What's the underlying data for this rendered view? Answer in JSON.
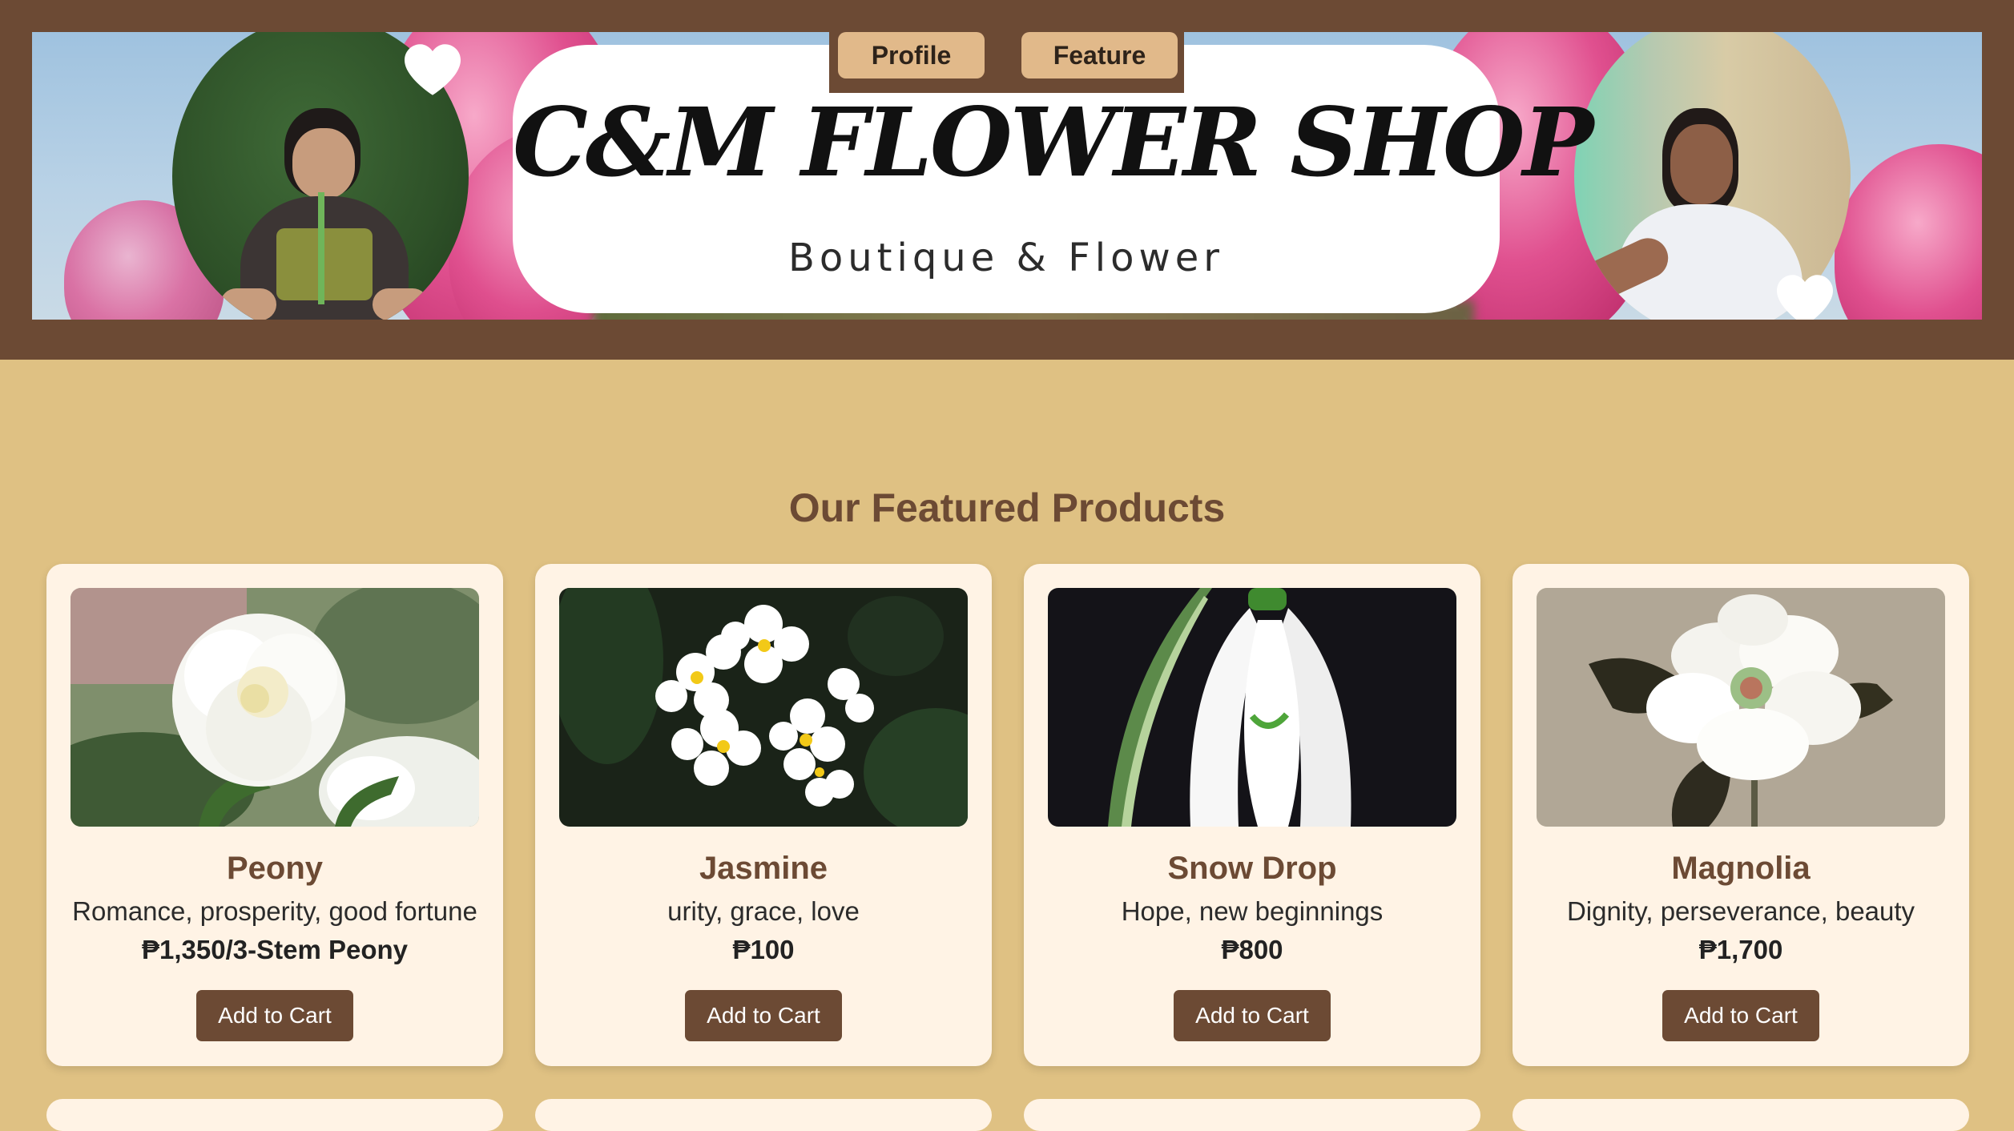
{
  "header": {
    "shop_name": "C&M FLOWER SHOP",
    "tagline": "Boutique & Flower",
    "nav": {
      "profile_label": "Profile",
      "feature_label": "Feature"
    }
  },
  "main": {
    "section_title": "Our Featured Products",
    "products": [
      {
        "name": "Peony",
        "description": "Romance, prosperity, good fortune",
        "price": "₱1,350/3-Stem Peony",
        "button_label": "Add to Cart"
      },
      {
        "name": "Jasmine",
        "description": "urity, grace, love",
        "price": "₱100",
        "button_label": "Add to Cart"
      },
      {
        "name": "Snow Drop",
        "description": "Hope, new beginnings",
        "price": "₱800",
        "button_label": "Add to Cart"
      },
      {
        "name": "Magnolia",
        "description": "Dignity, perseverance, beauty",
        "price": "₱1,700",
        "button_label": "Add to Cart"
      }
    ]
  },
  "colors": {
    "header_brown": "#6c4a34",
    "page_tan": "#dfc183",
    "card_cream": "#fff3e5",
    "nav_button": "#e1b98a"
  },
  "icons": [
    "heart-icon"
  ]
}
